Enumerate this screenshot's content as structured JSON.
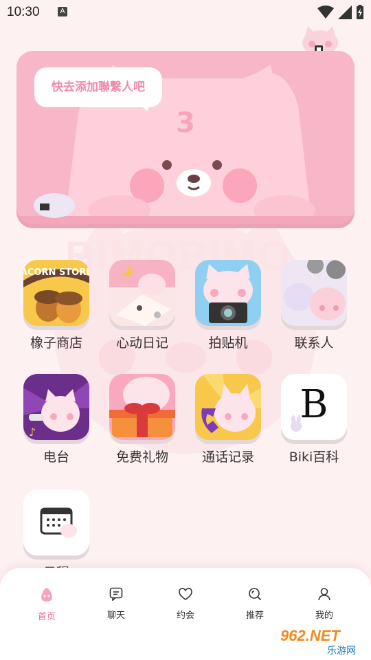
{
  "status_bar": {
    "time": "10:30",
    "notification_icon": "A"
  },
  "banner": {
    "bubble_text": "快去添加聯繫人吧"
  },
  "apps": [
    {
      "label": "橡子商店",
      "icon_text": "ACORN STORE"
    },
    {
      "label": "心动日记"
    },
    {
      "label": "拍贴机"
    },
    {
      "label": "联系人"
    },
    {
      "label": "电台"
    },
    {
      "label": "免费礼物"
    },
    {
      "label": "通话记录"
    },
    {
      "label": "Biki百科",
      "icon_text": "B"
    },
    {
      "label": "日程"
    }
  ],
  "watermark_text": "BIMOBIMO",
  "nav": [
    {
      "label": "首页",
      "active": true
    },
    {
      "label": "聊天"
    },
    {
      "label": "约会"
    },
    {
      "label": "推荐"
    },
    {
      "label": "我的"
    }
  ],
  "brand": {
    "line1": "962.NET",
    "line2": "乐游网"
  },
  "colors": {
    "accent": "#f06a8f",
    "banner": "#f8b7c8",
    "background": "#fdf1f2"
  }
}
